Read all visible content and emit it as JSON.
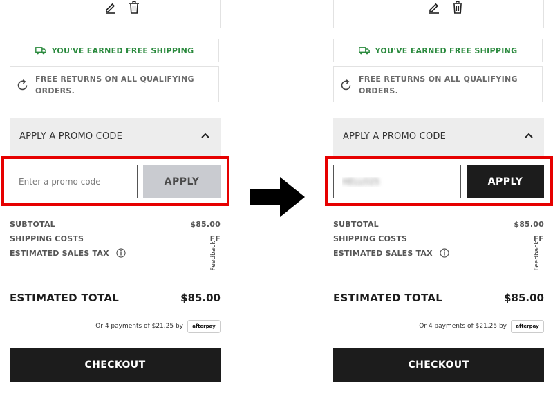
{
  "panels": [
    {
      "id": "before",
      "free_shipping": "YOU'VE EARNED FREE SHIPPING",
      "free_returns": "FREE RETURNS ON ALL QUALIFYING ORDERS.",
      "promo_header": "APPLY A PROMO CODE",
      "promo_input": {
        "value": "",
        "placeholder": "Enter a promo code"
      },
      "apply_label": "APPLY",
      "apply_state": "disabled",
      "subtotal_label": "SUBTOTAL",
      "subtotal_value": "$85.00",
      "shipping_label": "SHIPPING COSTS",
      "shipping_value": "FF",
      "tax_label": "ESTIMATED SALES TAX",
      "feedback": "Feedback",
      "total_label": "ESTIMATED TOTAL",
      "total_value": "$85.00",
      "afterpay_text": "Or 4 payments of $21.25 by",
      "afterpay_logo": "afterpay",
      "checkout_label": "CHECKOUT"
    },
    {
      "id": "after",
      "free_shipping": "YOU'VE EARNED FREE SHIPPING",
      "free_returns": "FREE RETURNS ON ALL QUALIFYING ORDERS.",
      "promo_header": "APPLY A PROMO CODE",
      "promo_input": {
        "value": "HELLO25",
        "placeholder": "Enter a promo code"
      },
      "apply_label": "APPLY",
      "apply_state": "active",
      "subtotal_label": "SUBTOTAL",
      "subtotal_value": "$85.00",
      "shipping_label": "SHIPPING COSTS",
      "shipping_value": "FF",
      "tax_label": "ESTIMATED SALES TAX",
      "feedback": "Feedback",
      "total_label": "ESTIMATED TOTAL",
      "total_value": "$85.00",
      "afterpay_text": "Or 4 payments of $21.25 by",
      "afterpay_logo": "afterpay",
      "checkout_label": "CHECKOUT"
    }
  ],
  "colors": {
    "highlight": "#e60000",
    "shipping_green": "#2b8a3e",
    "dark": "#1c1c1c",
    "disabled_button": "#c9cbd0",
    "promo_header_bg": "#ededed"
  },
  "icons": {
    "edit": "pencil-icon",
    "delete": "trash-icon",
    "shipping": "truck-icon",
    "returns": "refresh-icon",
    "collapse": "chevron-up-icon",
    "info": "info-icon",
    "transition": "right-arrow-icon"
  }
}
